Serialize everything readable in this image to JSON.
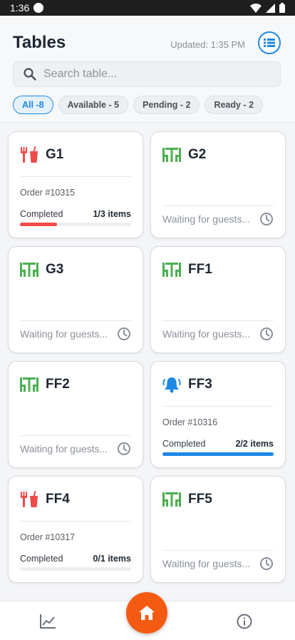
{
  "status_bar": {
    "time": "1:36"
  },
  "header": {
    "title": "Tables",
    "updated": "Updated: 1:35 PM",
    "view_toggle_icon": "list-view-icon"
  },
  "search": {
    "placeholder": "Search table...",
    "value": ""
  },
  "filters": [
    {
      "label": "All -8",
      "active": true
    },
    {
      "label": "Available - 5",
      "active": false
    },
    {
      "label": "Pending - 2",
      "active": false
    },
    {
      "label": "Ready - 2",
      "active": false
    }
  ],
  "colors": {
    "accent": "#1e88e5",
    "pending": "#f04b4b",
    "available": "#4caf50",
    "ready": "#1e88e5",
    "fab": "#f55a12"
  },
  "tables": [
    {
      "name": "G1",
      "status": "pending",
      "icon": "utensils-icon",
      "order": "Order #10315",
      "progress_label": "Completed",
      "progress_count": "1/3 items",
      "progress": 0.333
    },
    {
      "name": "G2",
      "status": "available",
      "icon": "table-chairs-icon",
      "waiting": "Waiting for guests..."
    },
    {
      "name": "G3",
      "status": "available",
      "icon": "table-chairs-icon",
      "waiting": "Waiting for guests..."
    },
    {
      "name": "FF1",
      "status": "available",
      "icon": "table-chairs-icon",
      "waiting": "Waiting for guests..."
    },
    {
      "name": "FF2",
      "status": "available",
      "icon": "table-chairs-icon",
      "waiting": "Waiting for guests..."
    },
    {
      "name": "FF3",
      "status": "ready",
      "icon": "bell-icon",
      "order": "Order #10316",
      "progress_label": "Completed",
      "progress_count": "2/2 items",
      "progress": 1.0
    },
    {
      "name": "FF4",
      "status": "pending",
      "icon": "utensils-icon",
      "order": "Order #10317",
      "progress_label": "Completed",
      "progress_count": "0/1 items",
      "progress": 0.0
    },
    {
      "name": "FF5",
      "status": "available",
      "icon": "table-chairs-icon",
      "waiting": "Waiting for guests..."
    }
  ],
  "bottom_nav": {
    "left_icon": "stats-chart-icon",
    "center_icon": "home-icon",
    "right_icon": "info-icon"
  }
}
